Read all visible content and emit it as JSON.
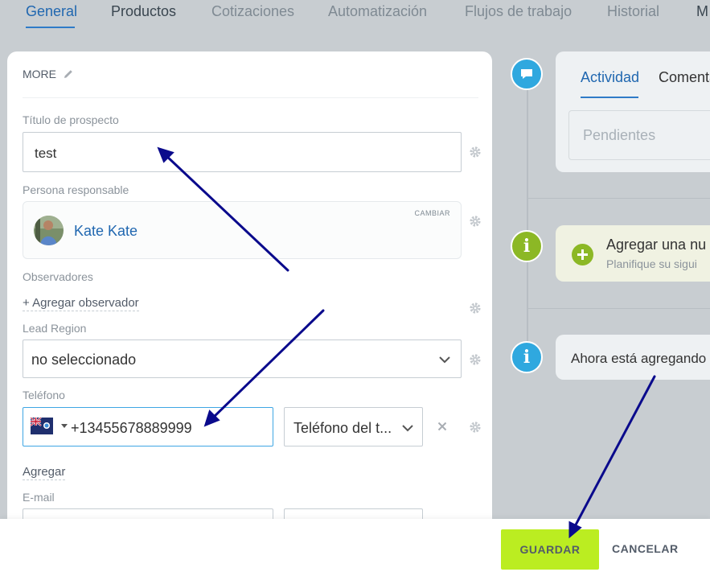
{
  "top_tabs": [
    {
      "label": "General"
    },
    {
      "label": "Productos"
    },
    {
      "label": "Cotizaciones"
    },
    {
      "label": "Automatización"
    },
    {
      "label": "Flujos de trabajo"
    },
    {
      "label": "Historial"
    },
    {
      "label": "M"
    }
  ],
  "form": {
    "section_title": "MORE",
    "title_label": "Título de prospecto",
    "title_value": "test",
    "responsible_label": "Persona responsable",
    "responsible_change": "CAMBIAR",
    "responsible_name": "Kate Kate",
    "observers_label": "Observadores",
    "add_observer": "+ Agregar observador",
    "region_label": "Lead Region",
    "region_value": "no seleccionado",
    "phone_label": "Teléfono",
    "phone_value": "+13455678889999",
    "phone_type": "Teléfono del t...",
    "add_label": "Agregar",
    "email_label": "E-mail"
  },
  "activity": {
    "tabs": [
      "Actividad",
      "Comenta"
    ],
    "pending_placeholder": "Pendientes",
    "suggest_title": "Agregar una nu",
    "suggest_sub": "Planifique su sigui",
    "info_text": "Ahora está agregando"
  },
  "timeline_icons": [
    "chat-bubble-icon",
    "info-icon",
    "info-icon"
  ],
  "footer": {
    "save_label": "GUARDAR",
    "cancel_label": "CANCELAR"
  },
  "colors": {
    "accent": "#2067b0",
    "save_button": "#bbed21",
    "annotation_arrow": "#0a0a8c",
    "timeline_blue": "#2fa8df",
    "timeline_green": "#8cb825"
  }
}
